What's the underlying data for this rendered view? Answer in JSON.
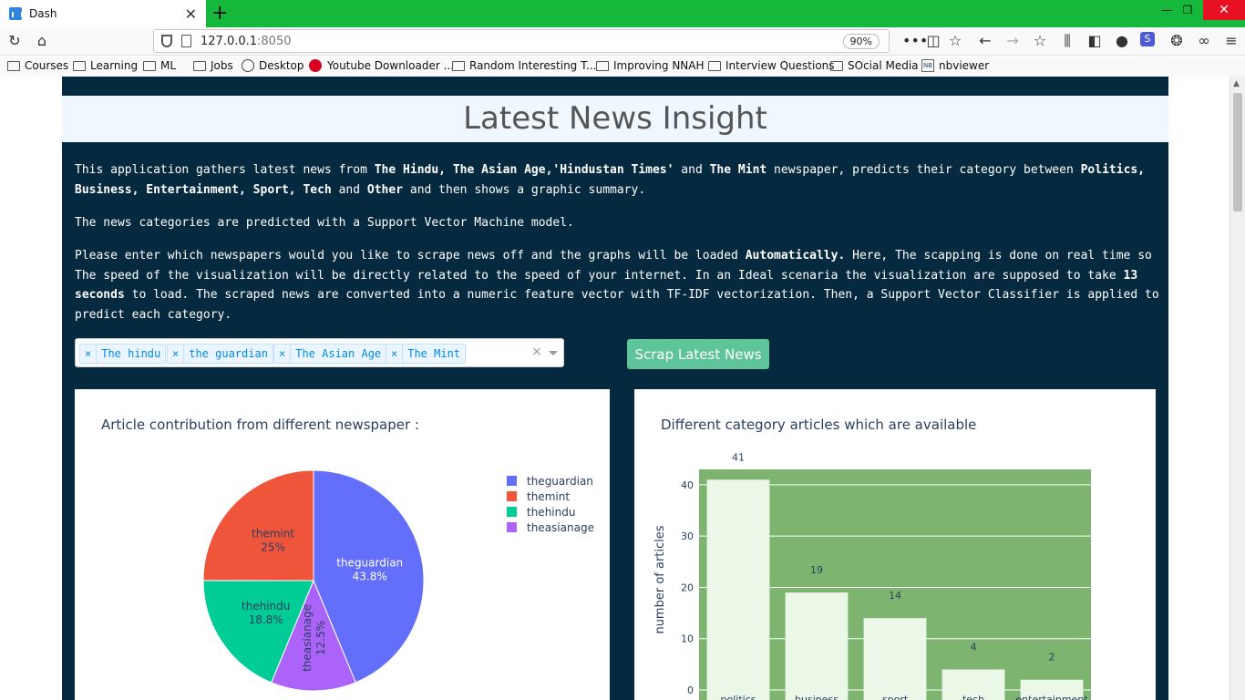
{
  "browser": {
    "tab_title": "Dash",
    "url_host": "127.0.0.1",
    "url_port": ":8050",
    "zoom": "90%",
    "bookmarks": [
      {
        "label": "Courses",
        "icon": "folder-icon"
      },
      {
        "label": "Learning",
        "icon": "folder-icon"
      },
      {
        "label": "ML",
        "icon": "folder-icon"
      },
      {
        "label": "Jobs",
        "icon": "folder-icon"
      },
      {
        "label": "Desktop",
        "icon": "globe-icon"
      },
      {
        "label": "Youtube Downloader ...",
        "icon": "youtube-downloader-icon"
      },
      {
        "label": "Random Interesting T...",
        "icon": "folder-icon"
      },
      {
        "label": "Improving NNAH",
        "icon": "folder-icon"
      },
      {
        "label": "Interview Questions",
        "icon": "folder-icon"
      },
      {
        "label": "SOcial Media",
        "icon": "folder-icon"
      },
      {
        "label": "nbviewer",
        "icon": "nbviewer-icon"
      }
    ]
  },
  "app": {
    "title": "Latest News Insight",
    "intro": {
      "p1_a": "This application gathers latest news from ",
      "p1_b": "The Hindu, The Asian Age,'Hindustan Times'",
      "p1_c": " and ",
      "p1_d": "The Mint",
      "p1_e": " newspaper, predicts their category between ",
      "p1_f": "Politics, Business, Entertainment, Sport, Tech",
      "p1_g": " and ",
      "p1_h": "Other",
      "p1_i": " and then shows a graphic summary.",
      "p2": "The news categories are predicted with a Support Vector Machine model.",
      "p3_a": "Please enter which newspapers would you like to scrape news off and the graphs will be loaded ",
      "p3_b": "Automatically.",
      "p3_c": " Here, The scapping is done on real time so The speed of the visualization will be directly related to the speed of your internet. In an Ideal scenaria the visualization are supposed to take ",
      "p3_d": "13 seconds",
      "p3_e": " to load. The scraped news are converted into a numeric feature vector with TF-IDF vectorization. Then, a Support Vector Classifier is applied to predict each category."
    },
    "dropdown": {
      "selected": [
        "The hindu",
        "the guardian",
        "The Asian Age",
        "The Mint"
      ],
      "remove_glyph": "×",
      "clear_glyph": "×"
    },
    "button_label": "Scrap Latest News",
    "colors": {
      "background": "#052a40",
      "title_band": "#f0f8ff",
      "button": "#5ec49a"
    }
  },
  "chart_data": [
    {
      "type": "pie",
      "title": "Article contribution from different newspaper :",
      "labels": [
        "theguardian",
        "themint",
        "thehindu",
        "theasianage"
      ],
      "values": [
        43.8,
        25,
        18.8,
        12.5
      ],
      "text": [
        "43.8%",
        "25%",
        "18.8%",
        "12.5%"
      ],
      "colors": [
        "#636efa",
        "#ef553b",
        "#00cc96",
        "#ab63fa"
      ],
      "legend": "top-right"
    },
    {
      "type": "bar",
      "title": "Different category articles which are available",
      "categories": [
        "politics",
        "business",
        "sport",
        "tech",
        "entertainment"
      ],
      "values": [
        41,
        19,
        14,
        4,
        2
      ],
      "ylabel": "number of articles",
      "yticks": [
        0,
        10,
        20,
        30,
        40
      ],
      "ylim": [
        0,
        43
      ],
      "bar_color": "#ebf8e8",
      "plot_bg": "#7cb470",
      "grid": true
    }
  ]
}
